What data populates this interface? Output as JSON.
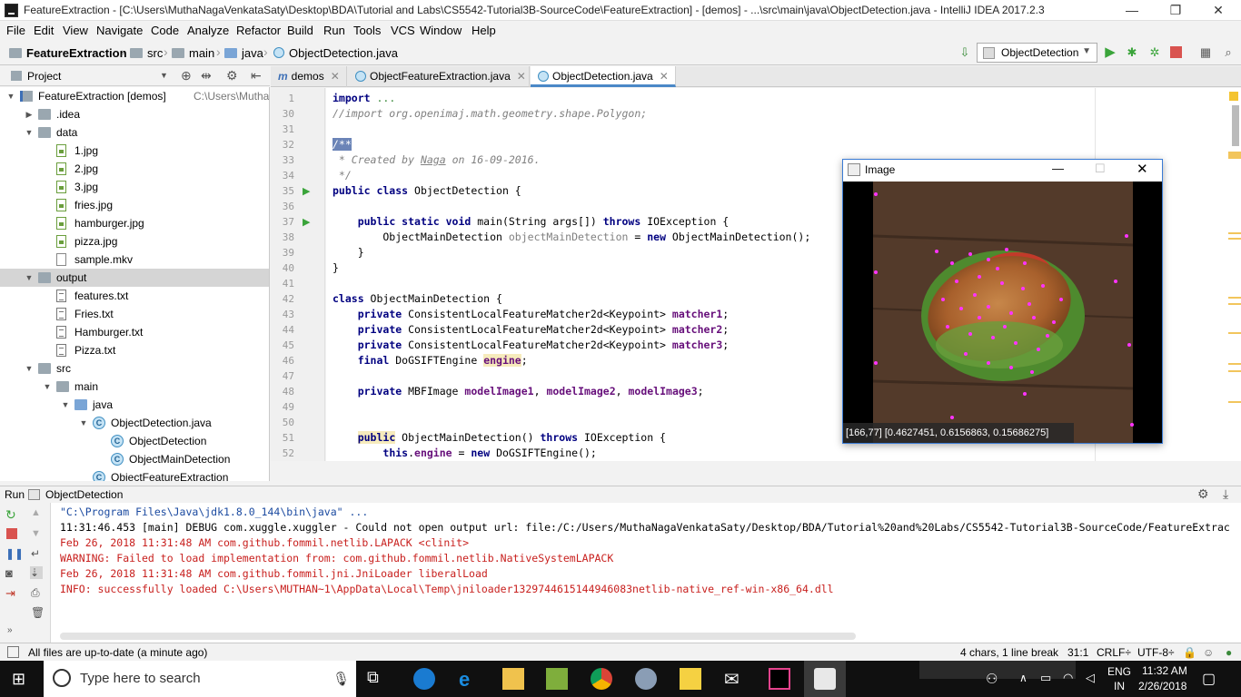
{
  "window": {
    "title": "FeatureExtraction - [C:\\Users\\MuthaNagaVenkataSaty\\Desktop\\BDA\\Tutorial and Labs\\CS5542-Tutorial3B-SourceCode\\FeatureExtraction] - [demos] - ...\\src\\main\\java\\ObjectDetection.java - IntelliJ IDEA 2017.2.3",
    "minimize": "—",
    "restore": "❐",
    "close": "✕"
  },
  "menu": [
    "File",
    "Edit",
    "View",
    "Navigate",
    "Code",
    "Analyze",
    "Refactor",
    "Build",
    "Run",
    "Tools",
    "VCS",
    "Window",
    "Help"
  ],
  "breadcrumbs": [
    "FeatureExtraction",
    "src",
    "main",
    "java",
    "ObjectDetection.java"
  ],
  "run_config": "ObjectDetection",
  "project_panel": {
    "title": "Project",
    "tree": [
      {
        "label": "FeatureExtraction [demos]",
        "extra": "C:\\Users\\MuthaNaga",
        "indent": 0,
        "arrow": "▼",
        "icon": "module"
      },
      {
        "label": ".idea",
        "indent": 1,
        "arrow": "▶",
        "icon": "folder"
      },
      {
        "label": "data",
        "indent": 1,
        "arrow": "▼",
        "icon": "folder"
      },
      {
        "label": "1.jpg",
        "indent": 2,
        "arrow": "",
        "icon": "img"
      },
      {
        "label": "2.jpg",
        "indent": 2,
        "arrow": "",
        "icon": "img"
      },
      {
        "label": "3.jpg",
        "indent": 2,
        "arrow": "",
        "icon": "img"
      },
      {
        "label": "fries.jpg",
        "indent": 2,
        "arrow": "",
        "icon": "img"
      },
      {
        "label": "hamburger.jpg",
        "indent": 2,
        "arrow": "",
        "icon": "img"
      },
      {
        "label": "pizza.jpg",
        "indent": 2,
        "arrow": "",
        "icon": "img"
      },
      {
        "label": "sample.mkv",
        "indent": 2,
        "arrow": "",
        "icon": "mkv"
      },
      {
        "label": "output",
        "indent": 1,
        "arrow": "▼",
        "icon": "folder",
        "selected": true
      },
      {
        "label": "features.txt",
        "indent": 2,
        "arrow": "",
        "icon": "txt"
      },
      {
        "label": "Fries.txt",
        "indent": 2,
        "arrow": "",
        "icon": "txt"
      },
      {
        "label": "Hamburger.txt",
        "indent": 2,
        "arrow": "",
        "icon": "txt"
      },
      {
        "label": "Pizza.txt",
        "indent": 2,
        "arrow": "",
        "icon": "txt"
      },
      {
        "label": "src",
        "indent": 1,
        "arrow": "▼",
        "icon": "folder"
      },
      {
        "label": "main",
        "indent": 2,
        "arrow": "▼",
        "icon": "folder"
      },
      {
        "label": "java",
        "indent": 3,
        "arrow": "▼",
        "icon": "folder-blue"
      },
      {
        "label": "ObjectDetection.java",
        "indent": 4,
        "arrow": "▼",
        "icon": "cls"
      },
      {
        "label": "ObjectDetection",
        "indent": 5,
        "arrow": "",
        "icon": "cls"
      },
      {
        "label": "ObjectMainDetection",
        "indent": 5,
        "arrow": "",
        "icon": "cls"
      },
      {
        "label": "ObjectFeatureExtraction",
        "indent": 4,
        "arrow": "",
        "icon": "cls"
      }
    ]
  },
  "editor_tabs": [
    {
      "label": "demos",
      "icon": "m",
      "active": false
    },
    {
      "label": "ObjectFeatureExtraction.java",
      "icon": "c",
      "active": false
    },
    {
      "label": "ObjectDetection.java",
      "icon": "c",
      "active": true
    }
  ],
  "line_numbers": [
    "1",
    "30",
    "31",
    "32",
    "33",
    "34",
    "35",
    "36",
    "37",
    "38",
    "39",
    "40",
    "41",
    "42",
    "43",
    "44",
    "45",
    "46",
    "47",
    "48",
    "49",
    "50",
    "51",
    "52"
  ],
  "image_window": {
    "title": "Image",
    "status": "[166,77] [0.4627451, 0.6156863, 0.15686275]"
  },
  "run_panel": {
    "label": "Run",
    "config": "ObjectDetection",
    "console": [
      {
        "text": "\"C:\\Program Files\\Java\\jdk1.8.0_144\\bin\\java\" ...",
        "color": "c-blue"
      },
      {
        "text": "11:31:46.453 [main] DEBUG com.xuggle.xuggler - Could not open output url: file:/C:/Users/MuthaNagaVenkataSaty/Desktop/BDA/Tutorial%20and%20Labs/CS5542-Tutorial3B-SourceCode/FeatureExtrac",
        "color": "c-black"
      },
      {
        "text": "Feb 26, 2018 11:31:48 AM com.github.fommil.netlib.LAPACK <clinit>",
        "color": "c-red"
      },
      {
        "text": "WARNING: Failed to load implementation from: com.github.fommil.netlib.NativeSystemLAPACK",
        "color": "c-red"
      },
      {
        "text": "Feb 26, 2018 11:31:48 AM com.github.fommil.jni.JniLoader liberalLoad",
        "color": "c-red"
      },
      {
        "text": "INFO: successfully loaded C:\\Users\\MUTHAN~1\\AppData\\Local\\Temp\\jniloader1329744615144946083netlib-native_ref-win-x86_64.dll",
        "color": "c-red"
      }
    ]
  },
  "status_bar": {
    "message": "All files are up-to-date (a minute ago)",
    "selection": "4 chars, 1 line break",
    "position": "31:1",
    "line_sep": "CRLF÷",
    "encoding": "UTF-8÷"
  },
  "taskbar": {
    "search_placeholder": "Type here to search",
    "lang_top": "ENG",
    "lang_bottom": "IN",
    "time": "11:32 AM",
    "date": "2/26/2018"
  }
}
